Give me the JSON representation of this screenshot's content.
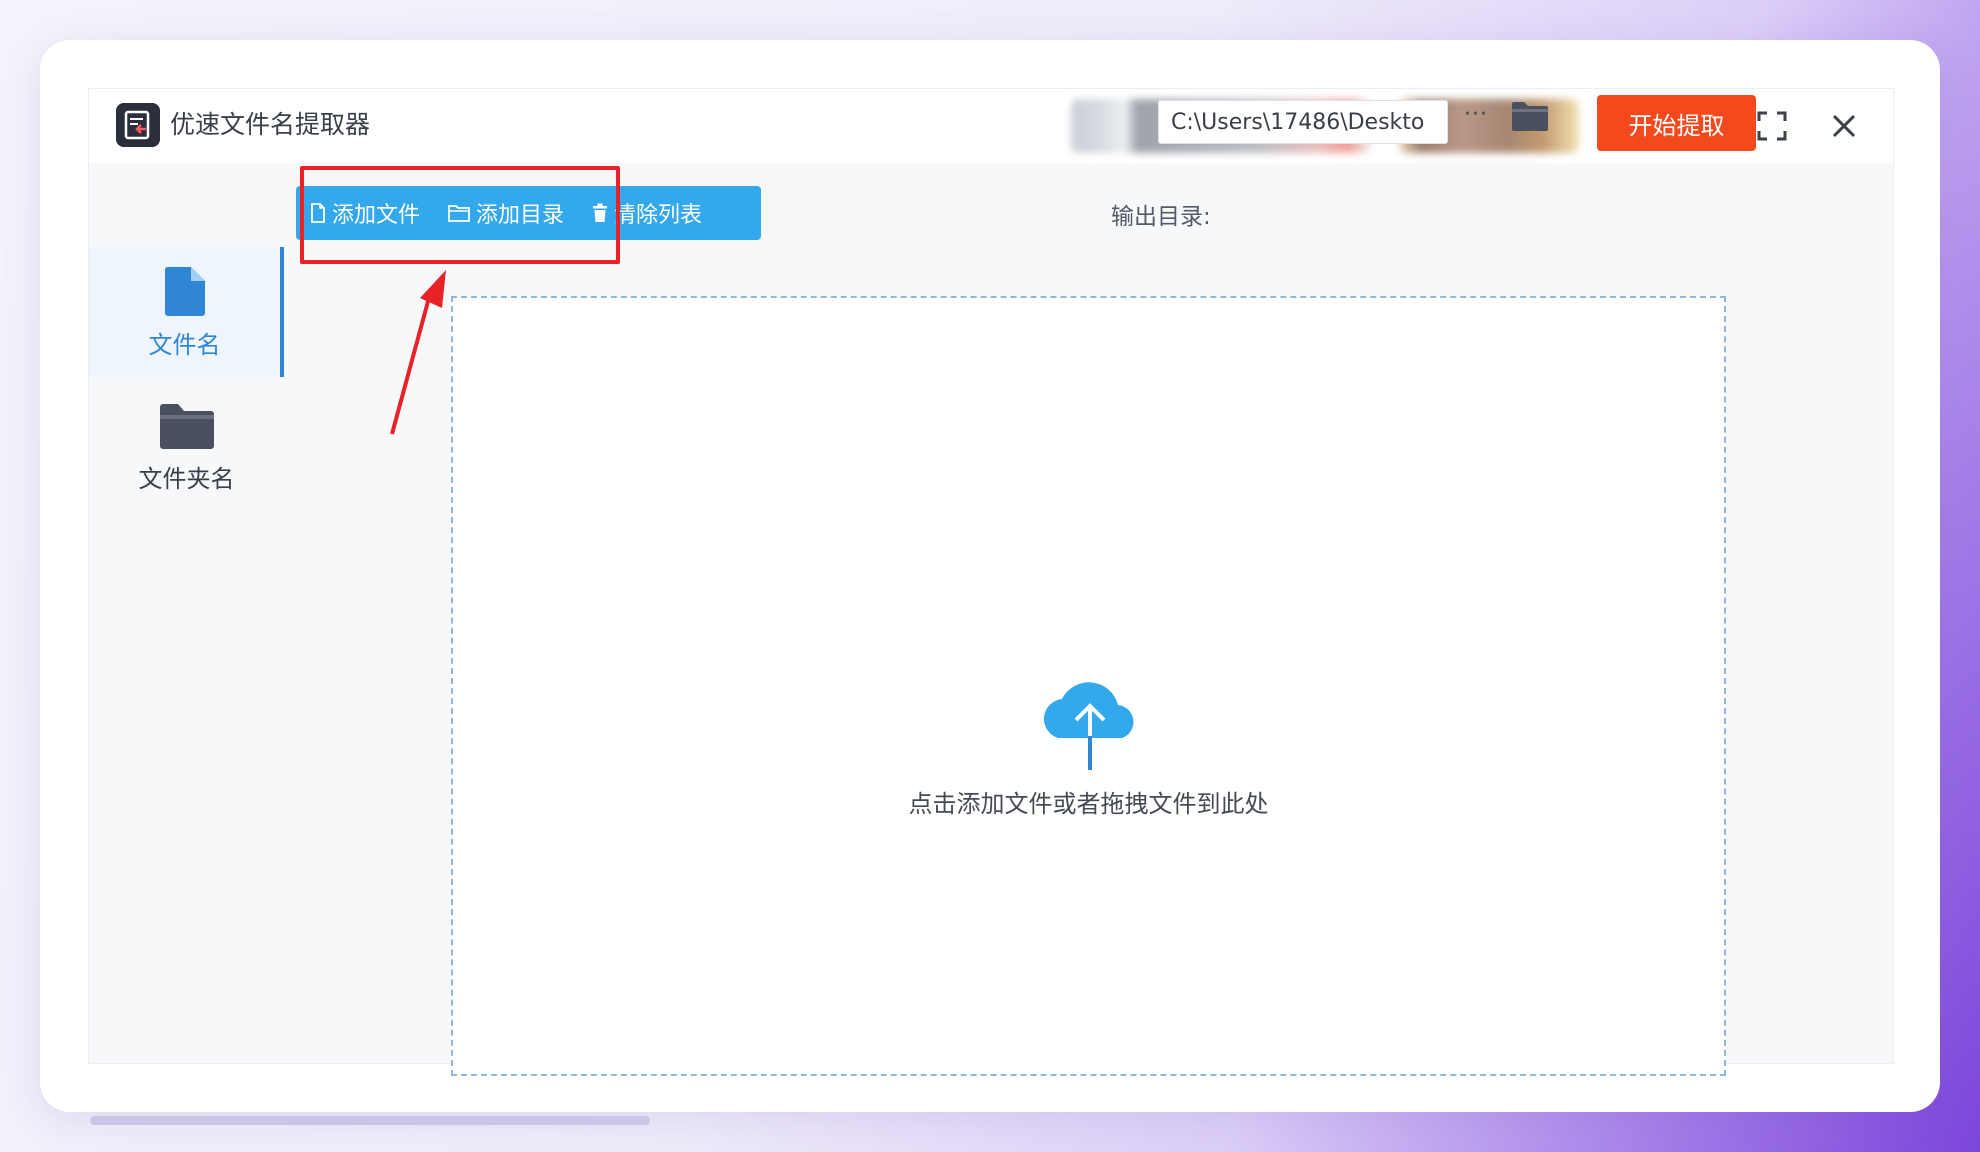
{
  "app": {
    "title": "优速文件名提取器"
  },
  "toolbar": {
    "add_file": "添加文件",
    "add_directory": "添加目录",
    "clear_list": "清除列表",
    "output_label": "输出目录:",
    "output_path": "C:\\Users\\17486\\Deskto",
    "more_label": "···",
    "start_label": "开始提取"
  },
  "sidebar": {
    "items": [
      {
        "label": "文件名",
        "icon": "file-icon",
        "active": true
      },
      {
        "label": "文件夹名",
        "icon": "folder-icon",
        "active": false
      }
    ]
  },
  "dropzone": {
    "hint": "点击添加文件或者拖拽文件到此处",
    "icon": "cloud-upload-icon"
  },
  "colors": {
    "primary_blue": "#33a8ec",
    "start_red": "#f4481d",
    "annotation_red": "#e82227",
    "active_blue": "#2f86d6"
  }
}
